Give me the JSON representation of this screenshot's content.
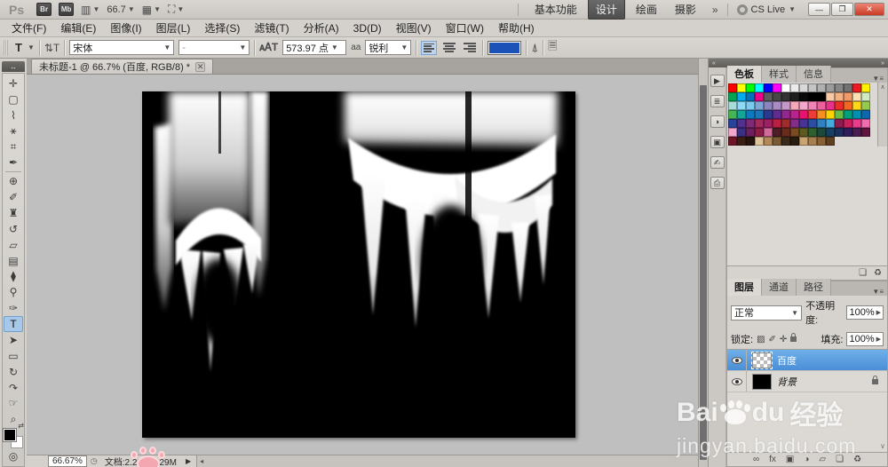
{
  "app_bar": {
    "logo": "Ps",
    "bridge_label": "Br",
    "minibridge_label": "Mb",
    "zoom_value": "66.7",
    "workspaces": [
      {
        "label": "基本功能",
        "active": false
      },
      {
        "label": "设计",
        "active": true
      },
      {
        "label": "绘画",
        "active": false
      },
      {
        "label": "摄影",
        "active": false
      }
    ],
    "workspace_overflow": "»",
    "cs_live_label": "CS Live",
    "window_buttons": {
      "minimize": "—",
      "restore": "❐",
      "close": "✕"
    }
  },
  "menu_bar": {
    "items": [
      "文件(F)",
      "编辑(E)",
      "图像(I)",
      "图层(L)",
      "选择(S)",
      "滤镜(T)",
      "分析(A)",
      "3D(D)",
      "视图(V)",
      "窗口(W)",
      "帮助(H)"
    ]
  },
  "options_bar": {
    "tool_letter": "T",
    "font_family": "宋体",
    "font_style": "-",
    "size_value": "573.97 点",
    "anti_alias_label": "aa",
    "anti_alias_value": "锐利",
    "text_color": "#1c51b8"
  },
  "document_tab": {
    "title": "未标题-1 @ 66.7% (百度, RGB/8) *",
    "close": "✕"
  },
  "toolbar": {
    "collapse_glyph": "↔",
    "tools": [
      {
        "name": "move-tool",
        "glyph": "✛"
      },
      {
        "name": "marquee-tool",
        "glyph": "▢"
      },
      {
        "name": "lasso-tool",
        "glyph": "⌇"
      },
      {
        "name": "quick-selection-tool",
        "glyph": "⚹"
      },
      {
        "name": "crop-tool",
        "glyph": "⌗"
      },
      {
        "name": "eyedropper-tool",
        "glyph": "✒"
      },
      {
        "name": "healing-brush-tool",
        "glyph": "⊕"
      },
      {
        "name": "brush-tool",
        "glyph": "✐"
      },
      {
        "name": "clone-stamp-tool",
        "glyph": "♜"
      },
      {
        "name": "history-brush-tool",
        "glyph": "↺"
      },
      {
        "name": "eraser-tool",
        "glyph": "▱"
      },
      {
        "name": "gradient-tool",
        "glyph": "▤"
      },
      {
        "name": "blur-tool",
        "glyph": "⧫"
      },
      {
        "name": "dodge-tool",
        "glyph": "⚲"
      },
      {
        "name": "pen-tool",
        "glyph": "✑"
      },
      {
        "name": "type-tool",
        "glyph": "T",
        "selected": true
      },
      {
        "name": "path-selection-tool",
        "glyph": "➤"
      },
      {
        "name": "shape-tool",
        "glyph": "▭"
      },
      {
        "name": "rotate-3d-tool",
        "glyph": "↻"
      },
      {
        "name": "orbit-3d-tool",
        "glyph": "↷"
      },
      {
        "name": "hand-tool",
        "glyph": "☞"
      },
      {
        "name": "zoom-tool",
        "glyph": "⌕"
      }
    ],
    "quick_mask_glyph": "◎"
  },
  "dock": {
    "collapse_left": "«",
    "collapse_right": "»",
    "strip_icons": [
      {
        "name": "actions-panel-icon",
        "glyph": "▶"
      },
      {
        "name": "history-panel-icon",
        "glyph": "≣"
      },
      {
        "name": "adjustments-panel-icon",
        "glyph": "◑"
      },
      {
        "name": "masks-panel-icon",
        "glyph": "▣"
      },
      {
        "name": "brush-panel-icon",
        "glyph": "✍"
      },
      {
        "name": "clone-source-panel-icon",
        "glyph": "⎙"
      }
    ]
  },
  "swatches_panel": {
    "tabs": [
      {
        "label": "色板",
        "active": true
      },
      {
        "label": "样式",
        "active": false
      },
      {
        "label": "信息",
        "active": false
      }
    ],
    "menu_glyph": "▼≡",
    "scroll_up_glyph": "∧",
    "footer_icons": [
      {
        "name": "new-swatch-icon",
        "glyph": "❏"
      },
      {
        "name": "delete-swatch-icon",
        "glyph": "♻"
      }
    ],
    "colors": [
      "#ff0000",
      "#ffff00",
      "#00ff00",
      "#00ffff",
      "#0000ff",
      "#ff00ff",
      "#ffffff",
      "#ececec",
      "#d9d9d9",
      "#c4c4c4",
      "#b0b0b0",
      "#9b9b9b",
      "#868686",
      "#717171",
      "#ed1c24",
      "#fff200",
      "#00a651",
      "#00aeef",
      "#0072bc",
      "#ec008c",
      "#5c5c5c",
      "#474747",
      "#333333",
      "#1f1f1f",
      "#0a0a0a",
      "#000000",
      "#000000",
      "#f7caa5",
      "#f4b184",
      "#f09a6a",
      "#fbe0b3",
      "#cfe9c2",
      "#a8dcd9",
      "#8ed8f8",
      "#7accee",
      "#7ea6d8",
      "#8a84c0",
      "#a98cc4",
      "#c697c9",
      "#f5a8b8",
      "#f5a6cb",
      "#f184b5",
      "#ee5f9e",
      "#e9318a",
      "#ee2c2c",
      "#f26722",
      "#ffd71a",
      "#96ca4f",
      "#46b654",
      "#12a69b",
      "#0c7ac0",
      "#1b75bb",
      "#2b3990",
      "#5f2d91",
      "#93278f",
      "#b8248c",
      "#e8136e",
      "#ee3d36",
      "#f78f1e",
      "#ffd400",
      "#6abd45",
      "#00a07c",
      "#0090b0",
      "#0d68b0",
      "#28439c",
      "#51308f",
      "#7e2a77",
      "#a32a5e",
      "#9c2063",
      "#bc1f43",
      "#a02c2c",
      "#832f8a",
      "#4a3397",
      "#2b4ea0",
      "#2f7fc1",
      "#45aadd",
      "#8c1d52",
      "#cc1f5e",
      "#e93c8c",
      "#f06eb0",
      "#f4a7cd",
      "#3a2f85",
      "#6d205f",
      "#8f1b47",
      "#d26a9c",
      "#4d1f24",
      "#6b2a1e",
      "#7a4a21",
      "#5d5a20",
      "#2f5e2f",
      "#1d4a38",
      "#173f63",
      "#1d2f5e",
      "#301d5e",
      "#4a1d52",
      "#611440",
      "#6e1426",
      "#3b1d14",
      "#24150d",
      "#dfc49a",
      "#b3885a",
      "#7c5a33",
      "#3a2a1a",
      "#281c10",
      "#c9a472",
      "#a77e4e",
      "#8a6134",
      "#5e3f1f"
    ]
  },
  "layers_panel": {
    "tabs": [
      {
        "label": "图层",
        "active": true
      },
      {
        "label": "通道",
        "active": false
      },
      {
        "label": "路径",
        "active": false
      }
    ],
    "menu_glyph": "▼≡",
    "blend_mode": "正常",
    "opacity_label": "不透明度:",
    "opacity_value": "100%",
    "lock_label": "锁定:",
    "fill_label": "填充:",
    "fill_value": "100%",
    "layers": [
      {
        "name": "百度",
        "selected": true
      },
      {
        "name": "背景",
        "selected": false,
        "locked": true
      }
    ],
    "footer_icons": [
      {
        "name": "link-layers-icon",
        "glyph": "∞"
      },
      {
        "name": "layer-style-icon",
        "glyph": "fx"
      },
      {
        "name": "layer-mask-icon",
        "glyph": "▣"
      },
      {
        "name": "adjustment-layer-icon",
        "glyph": "◑"
      },
      {
        "name": "new-group-icon",
        "glyph": "▱"
      },
      {
        "name": "new-layer-icon",
        "glyph": "❏"
      },
      {
        "name": "delete-layer-icon",
        "glyph": "♻"
      }
    ],
    "scroll_down_glyph": "∨"
  },
  "status_bar": {
    "zoom": "66.67%",
    "doc_info": "文档:2.29M/2.29M",
    "expand_glyph": "▶",
    "scroll_left_glyph": "◂"
  },
  "watermark": {
    "brand_prefix": "Bai",
    "brand_suffix": "du",
    "brand_cn": "经验",
    "url": "jingyan.baidu.com"
  }
}
